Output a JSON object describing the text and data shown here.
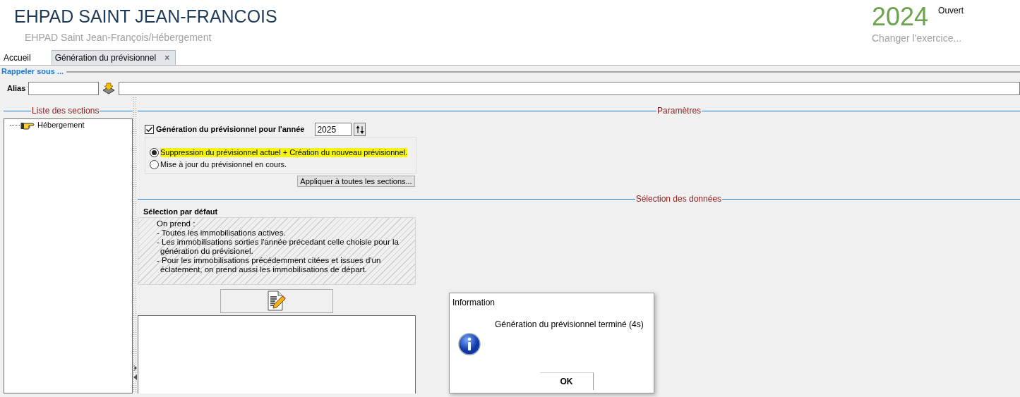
{
  "header": {
    "title": "EHPAD SAINT JEAN-FRANCOIS",
    "subtitle": "EHPAD Saint Jean-François/Hébergement",
    "year": "2024",
    "year_status": "Ouvert",
    "change_link": "Changer l'exercice..."
  },
  "tabs": [
    {
      "label": "Accueil",
      "selected": false
    },
    {
      "label": "Génération du prévisionnel",
      "selected": true,
      "close": "×"
    }
  ],
  "recall": {
    "title": "Rappeler sous ...",
    "alias_label": "Alias"
  },
  "sections": {
    "legend": "Liste des sections",
    "tree": [
      {
        "label": "Hébergement"
      }
    ]
  },
  "parameters": {
    "legend": "Paramètres",
    "generate_label": "Génération du prévisionnel pour l'année",
    "generate_checked": true,
    "year": "2025",
    "options": [
      {
        "label": "Suppression du prévisionnel actuel + Création du nouveau prévisionnel.",
        "selected": true,
        "highlighted": true
      },
      {
        "label": "Mise à jour du prévisionnel en cours.",
        "selected": false,
        "highlighted": false
      }
    ],
    "apply_button": "Appliquer à toutes les sections..."
  },
  "data_selection": {
    "legend": "Sélection des données",
    "group_title": "Sélection par défaut",
    "lines": [
      {
        "kind": "intro",
        "text": "On prend :"
      },
      {
        "kind": "item",
        "text": "- Toutes les immobilisations actives."
      },
      {
        "kind": "item",
        "text": "- Les immobilisations sorties l'année précedant celle choisie pour la"
      },
      {
        "kind": "continuation",
        "text": "génération du prévisionel."
      },
      {
        "kind": "item",
        "text": "- Pour les immobilisations précédemment citées et issues d'un"
      },
      {
        "kind": "continuation",
        "text": "éclatement, on prend aussi les immobilisations de départ."
      }
    ]
  },
  "dialog": {
    "title": "Information",
    "message": "Génération du prévisionnel terminé (4s)",
    "button": "OK"
  }
}
